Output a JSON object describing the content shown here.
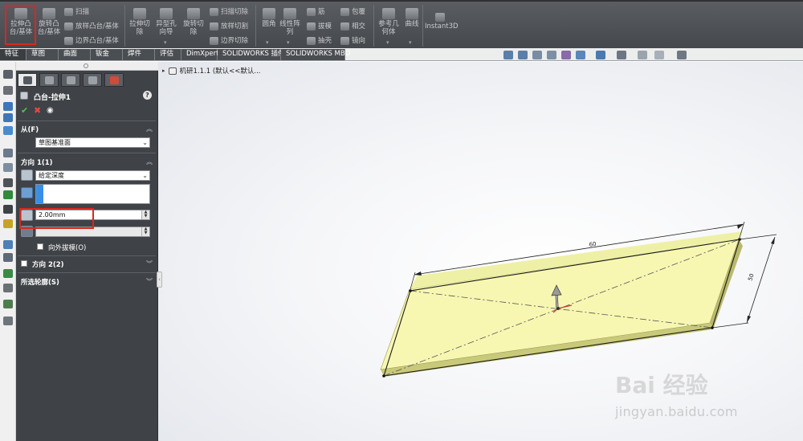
{
  "ribbon": {
    "extrude_boss": "拉伸凸\n台/基体",
    "revolve_boss": "旋转凸\n台/基体",
    "sweep": "扫描",
    "loft_boss": "放样凸台/基体",
    "boundary_boss": "边界凸台/基体",
    "extrude_cut": "拉伸切\n除",
    "hole_wizard": "异型孔\n向导",
    "revolve_cut": "旋转切\n除",
    "swept_cut": "扫描切除",
    "lofted_cut": "放样切割",
    "boundary_cut": "边界切除",
    "fillet": "圆角",
    "linear_pattern": "线性阵\n列",
    "rib": "筋",
    "draft": "拔模",
    "shell": "抽壳",
    "wrap": "包覆",
    "intersect": "相交",
    "mirror": "镜向",
    "ref_geometry": "参考几\n何体",
    "curves": "曲线",
    "instant3d": "Instant3D"
  },
  "tabs": [
    "特征",
    "草图",
    "曲面",
    "钣金",
    "焊件",
    "评估",
    "DimXpert",
    "SOLIDWORKS 插件",
    "SOLIDWORKS MBD"
  ],
  "property_manager": {
    "title": "凸台-拉伸1",
    "from_section": {
      "header": "从(F)",
      "start_condition": "草图基准面"
    },
    "direction1": {
      "header": "方向 1(1)",
      "end_condition": "给定深度",
      "depth": "2.00mm",
      "draft_outward_label": "向外拔模(O)"
    },
    "direction2": {
      "header": "方向 2(2)"
    },
    "selected_contours": {
      "header": "所选轮廓(S)"
    }
  },
  "tree": {
    "part_label": "机研1.1.1  (默认<<默认..."
  },
  "dimensions": {
    "length": "60",
    "width": "50"
  },
  "watermark": {
    "brand": "Bai 经验",
    "url": "jingyan.baidu.com"
  },
  "colors": {
    "ribbon_bg": "#4f5256",
    "panel_bg": "#3f4246",
    "highlight": "#d9281f",
    "part_face": "#f8f8b0"
  }
}
